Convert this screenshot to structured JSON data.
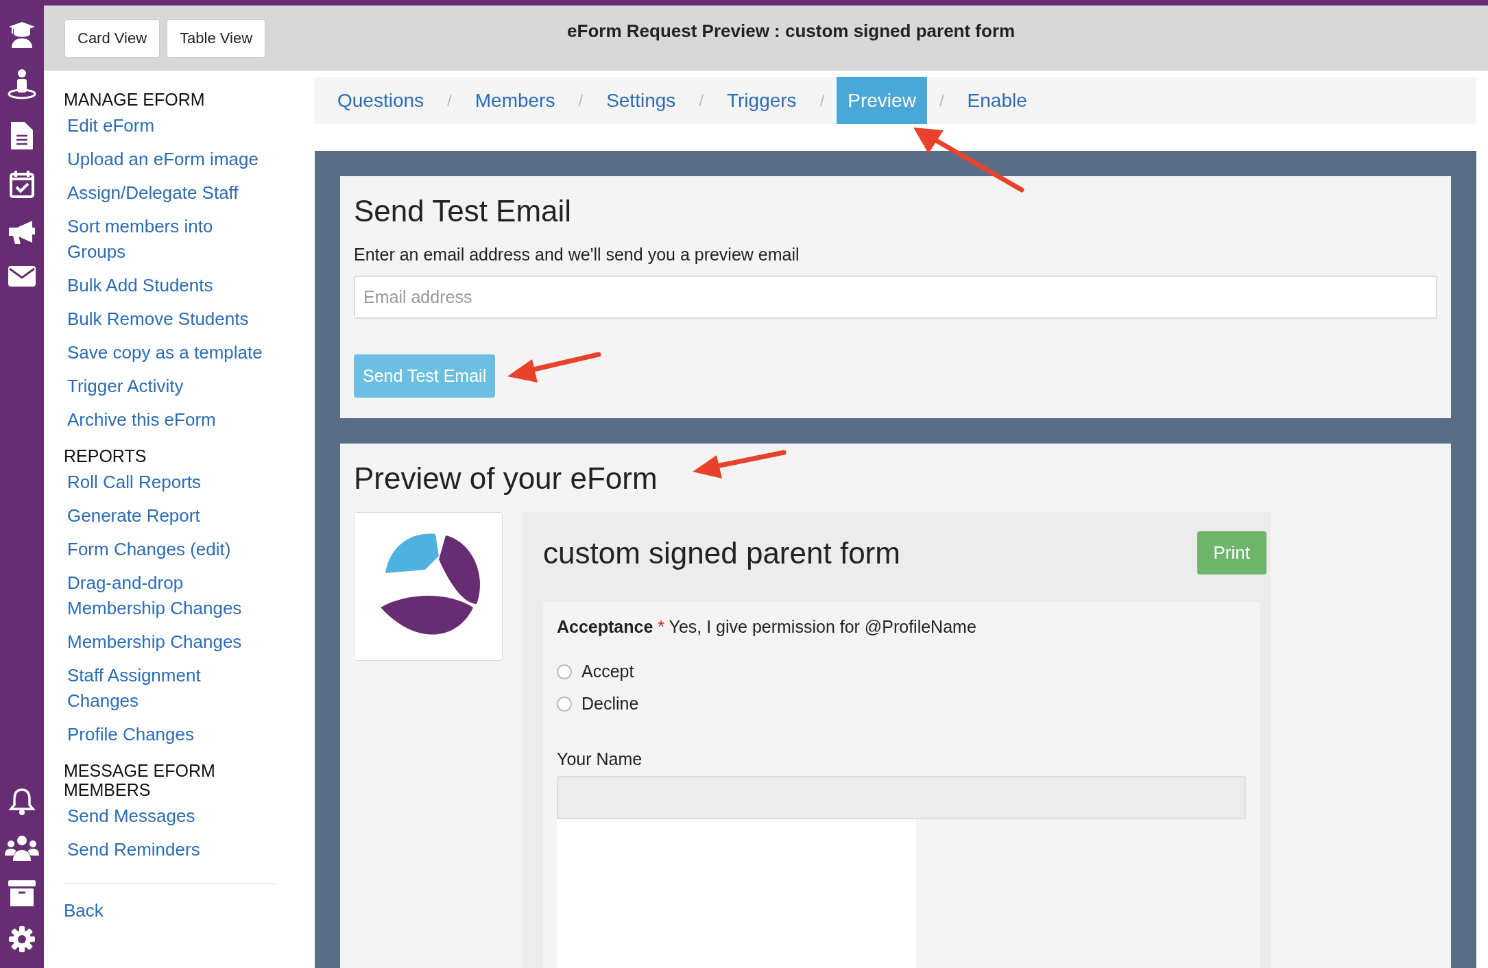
{
  "header": {
    "buttons": [
      "Card View",
      "Table View"
    ],
    "title": "eForm Request Preview : custom signed parent form"
  },
  "sidebar": {
    "sections": [
      {
        "heading": "MANAGE EFORM",
        "links": [
          "Edit eForm",
          "Upload an eForm image",
          "Assign/Delegate Staff",
          "Sort members into Groups",
          "Bulk Add Students",
          "Bulk Remove Students",
          "Save copy as a template",
          "Trigger Activity",
          "Archive this eForm"
        ]
      },
      {
        "heading": "REPORTS",
        "links": [
          "Roll Call Reports",
          "Generate Report",
          "Form Changes (edit)",
          "Drag-and-drop Membership Changes",
          "Membership Changes",
          "Staff Assignment Changes",
          "Profile Changes"
        ]
      },
      {
        "heading": "MESSAGE EFORM MEMBERS",
        "links": [
          "Send Messages",
          "Send Reminders"
        ]
      }
    ],
    "back": "Back"
  },
  "tabs": [
    {
      "label": "Questions",
      "selected": false,
      "separator": "/"
    },
    {
      "label": "Members",
      "selected": false,
      "separator": "/"
    },
    {
      "label": "Settings",
      "selected": false,
      "separator": "/"
    },
    {
      "label": "Triggers",
      "selected": false,
      "separator": "/"
    },
    {
      "label": "Preview",
      "selected": true,
      "separator": "/"
    },
    {
      "label": "Enable",
      "selected": false
    }
  ],
  "test_email": {
    "title": "Send Test Email",
    "description": "Enter an email address and we'll send you a preview email",
    "placeholder": "Email address",
    "button": "Send Test Email"
  },
  "preview": {
    "title": "Preview of your eForm",
    "form": {
      "title": "custom signed parent form",
      "print_button": "Print",
      "question": {
        "label": "Acceptance",
        "required_mark": "*",
        "text": "Yes, I give permission for @ProfileName",
        "options": [
          {
            "label": "Accept",
            "selected": false
          },
          {
            "label": "Decline",
            "selected": false
          }
        ]
      },
      "name_field": {
        "label": "Your Name"
      }
    }
  }
}
